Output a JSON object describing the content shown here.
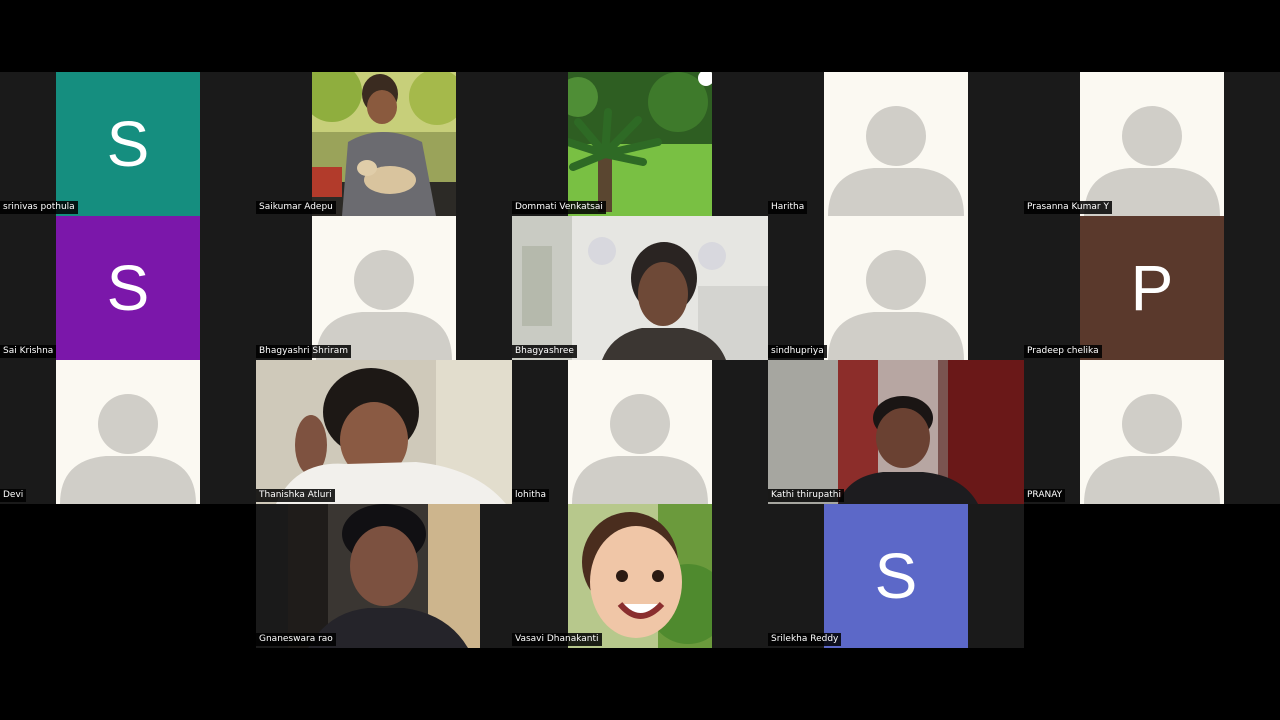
{
  "meeting": {
    "participants": [
      {
        "id": "p1",
        "name": "srinivas pothula",
        "avatar": "initial",
        "initial": "S",
        "color": "#158e7f"
      },
      {
        "id": "p2",
        "name": "Saikumar Adepu",
        "avatar": "photo",
        "photo": "man-holding-cat-photo"
      },
      {
        "id": "p3",
        "name": "Dommati Venkatsai",
        "avatar": "photo",
        "photo": "garden-palm-photo"
      },
      {
        "id": "p4",
        "name": "Haritha",
        "avatar": "default"
      },
      {
        "id": "p5",
        "name": "Prasanna Kumar Y",
        "avatar": "default"
      },
      {
        "id": "p6",
        "name": "Sai Krishna",
        "avatar": "initial",
        "initial": "S",
        "color": "#7b17aa"
      },
      {
        "id": "p7",
        "name": "Bhagyashri Shriram",
        "avatar": "default"
      },
      {
        "id": "p8",
        "name": "Bhagyashree",
        "avatar": "video",
        "photo": "woman-webcam-video"
      },
      {
        "id": "p9",
        "name": "sindhupriya",
        "avatar": "default"
      },
      {
        "id": "p10",
        "name": "Pradeep chelika",
        "avatar": "initial",
        "initial": "P",
        "color": "#5a392c"
      },
      {
        "id": "p11",
        "name": "Devi",
        "avatar": "default"
      },
      {
        "id": "p12",
        "name": "Thanishka Atluri",
        "avatar": "video",
        "photo": "woman-resting-chin-video"
      },
      {
        "id": "p13",
        "name": "lohitha",
        "avatar": "default"
      },
      {
        "id": "p14",
        "name": "Kathi thirupathi",
        "avatar": "video",
        "photo": "man-webcam-video"
      },
      {
        "id": "p15",
        "name": "PRANAY",
        "avatar": "default"
      },
      {
        "id": "p16",
        "name": "Gnaneswara rao",
        "avatar": "photo",
        "photo": "man-portrait-photo"
      },
      {
        "id": "p17",
        "name": "Vasavi Dhanakanti",
        "avatar": "photo",
        "photo": "smiling-child-photo"
      },
      {
        "id": "p18",
        "name": "Srilekha Reddy",
        "avatar": "initial",
        "initial": "S",
        "color": "#5c68c8"
      }
    ]
  }
}
